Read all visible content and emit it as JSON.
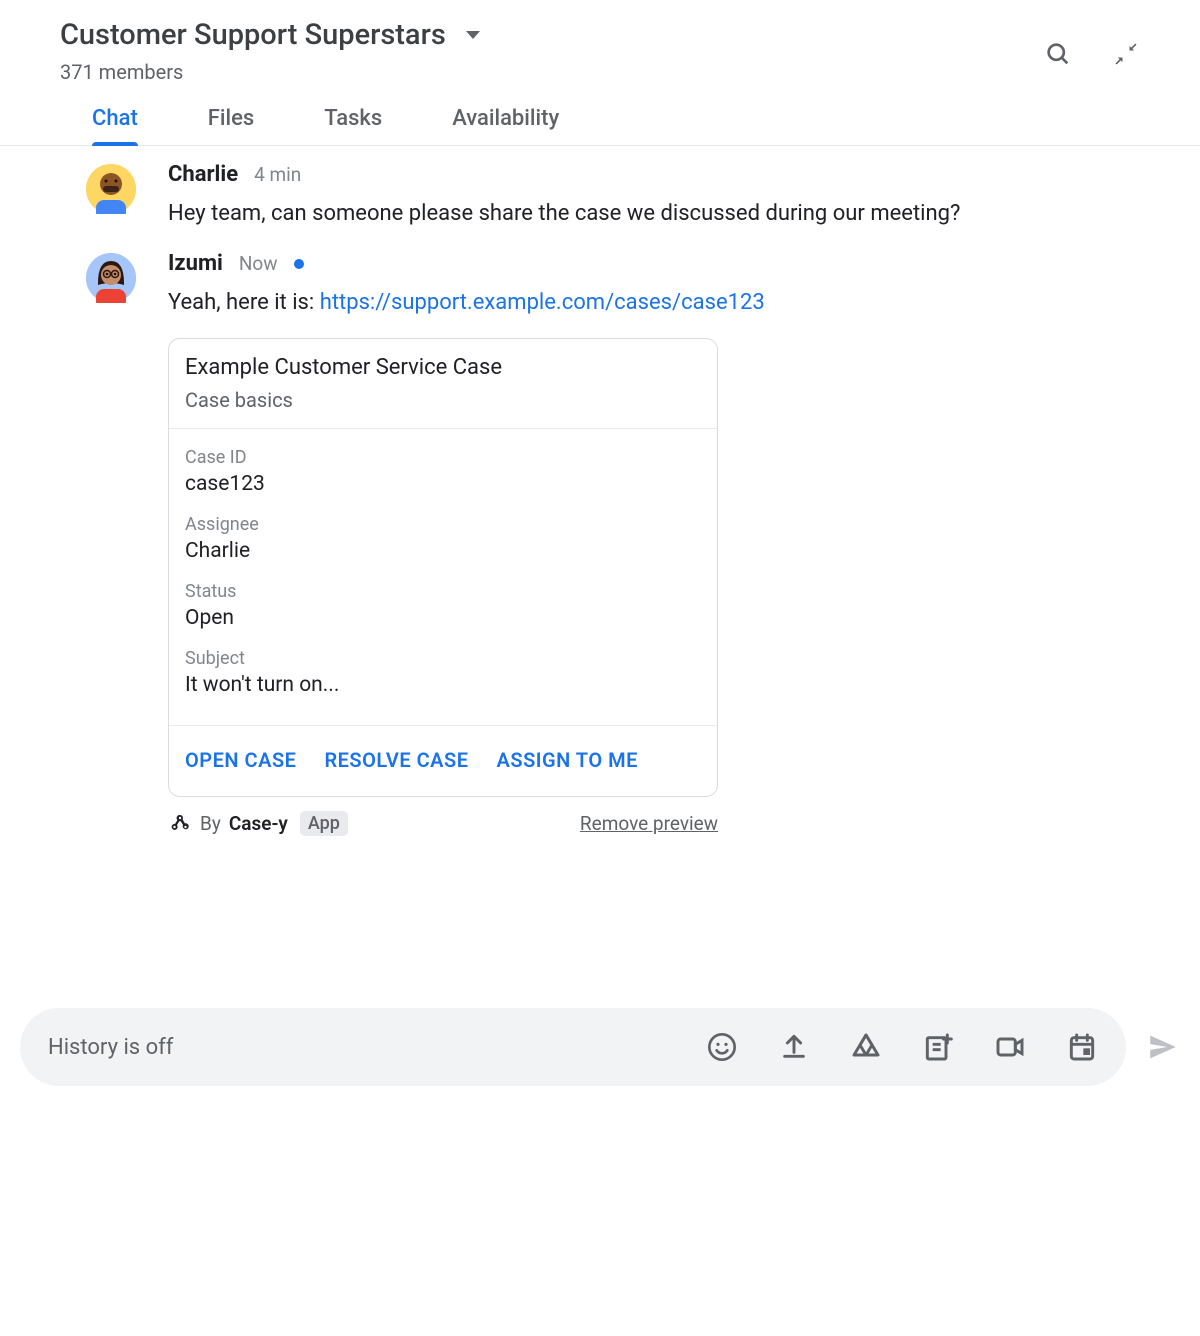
{
  "header": {
    "room_title": "Customer Support Superstars",
    "members": "371 members"
  },
  "tabs": {
    "items": [
      {
        "label": "Chat",
        "active": true
      },
      {
        "label": "Files",
        "active": false
      },
      {
        "label": "Tasks",
        "active": false
      },
      {
        "label": "Availability",
        "active": false
      }
    ]
  },
  "messages": [
    {
      "sender": "Charlie",
      "timestamp": "4 min",
      "text": "Hey team, can someone please share the case we discussed during our meeting?"
    },
    {
      "sender": "Izumi",
      "timestamp": "Now",
      "text_prefix": "Yeah, here it is: ",
      "link": "https://support.example.com/cases/case123"
    }
  ],
  "card": {
    "title": "Example Customer Service Case",
    "subtitle": "Case basics",
    "fields": [
      {
        "label": "Case ID",
        "value": "case123"
      },
      {
        "label": "Assignee",
        "value": "Charlie"
      },
      {
        "label": "Status",
        "value": "Open"
      },
      {
        "label": "Subject",
        "value": "It won't turn on..."
      }
    ],
    "actions": [
      {
        "label": "OPEN CASE"
      },
      {
        "label": "RESOLVE CASE"
      },
      {
        "label": "ASSIGN TO ME"
      }
    ]
  },
  "preview_footer": {
    "by_prefix": "By ",
    "app_name": "Case-y",
    "app_chip": "App",
    "remove": "Remove preview"
  },
  "composer": {
    "placeholder": "History is off"
  }
}
